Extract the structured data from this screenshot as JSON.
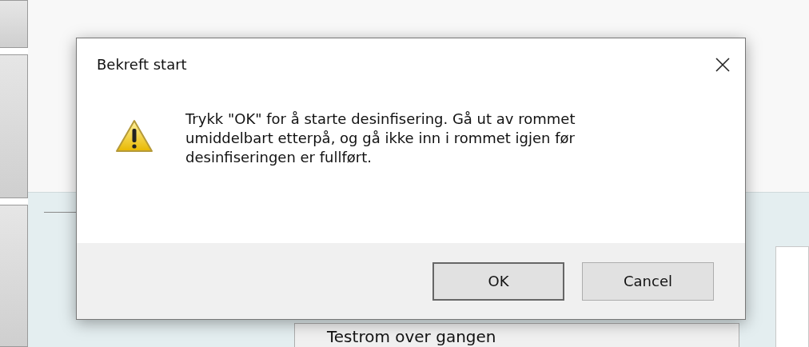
{
  "background": {
    "button_label": "Testrom over gangen"
  },
  "dialog": {
    "title": "Bekreft start",
    "message": "Trykk \"OK\" for å starte desinfisering. Gå ut av rommet umiddelbart etterpå, og gå ikke inn i rommet igjen før desinfiseringen er fullført.",
    "buttons": [
      {
        "label": "OK",
        "default": true
      },
      {
        "label": "Cancel",
        "default": false
      }
    ]
  }
}
